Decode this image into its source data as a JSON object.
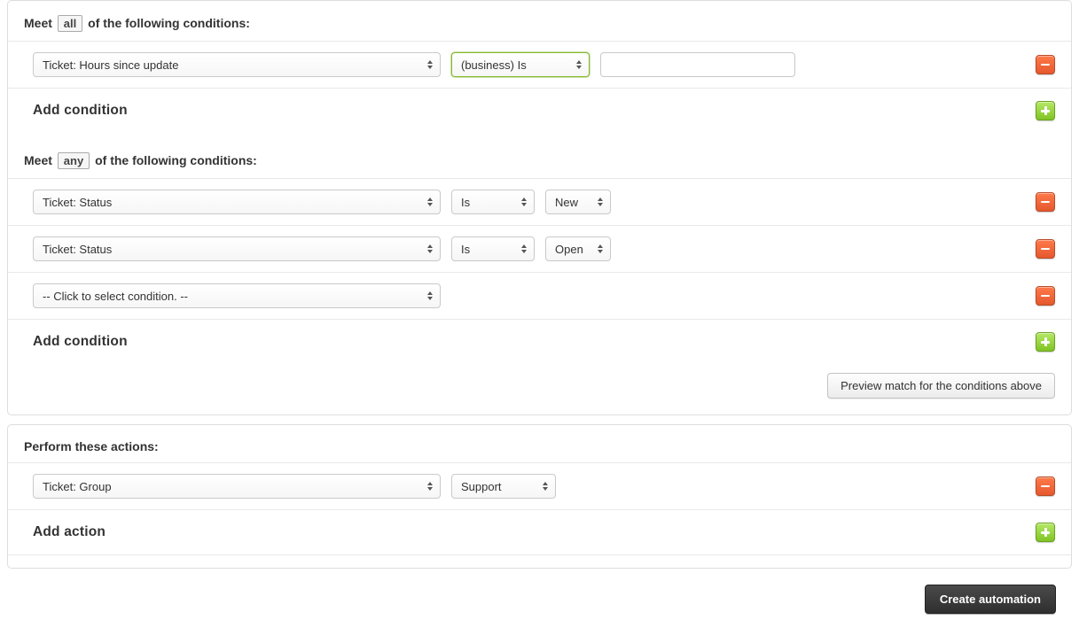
{
  "conditions": {
    "all": {
      "heading_prefix": "Meet",
      "chip": "all",
      "heading_suffix": "of the following conditions:",
      "rows": [
        {
          "field": "Ticket: Hours since update",
          "operator": "(business) Is",
          "value": ""
        }
      ],
      "add_label": "Add condition"
    },
    "any": {
      "heading_prefix": "Meet",
      "chip": "any",
      "heading_suffix": "of the following conditions:",
      "rows": [
        {
          "field": "Ticket: Status",
          "operator": "Is",
          "value": "New"
        },
        {
          "field": "Ticket: Status",
          "operator": "Is",
          "value": "Open"
        },
        {
          "field": "-- Click to select condition. --"
        }
      ],
      "add_label": "Add condition"
    },
    "preview_label": "Preview match for the conditions above"
  },
  "actions": {
    "heading": "Perform these actions:",
    "rows": [
      {
        "field": "Ticket: Group",
        "value": "Support"
      }
    ],
    "add_label": "Add action"
  },
  "footer": {
    "primary_label": "Create automation"
  }
}
